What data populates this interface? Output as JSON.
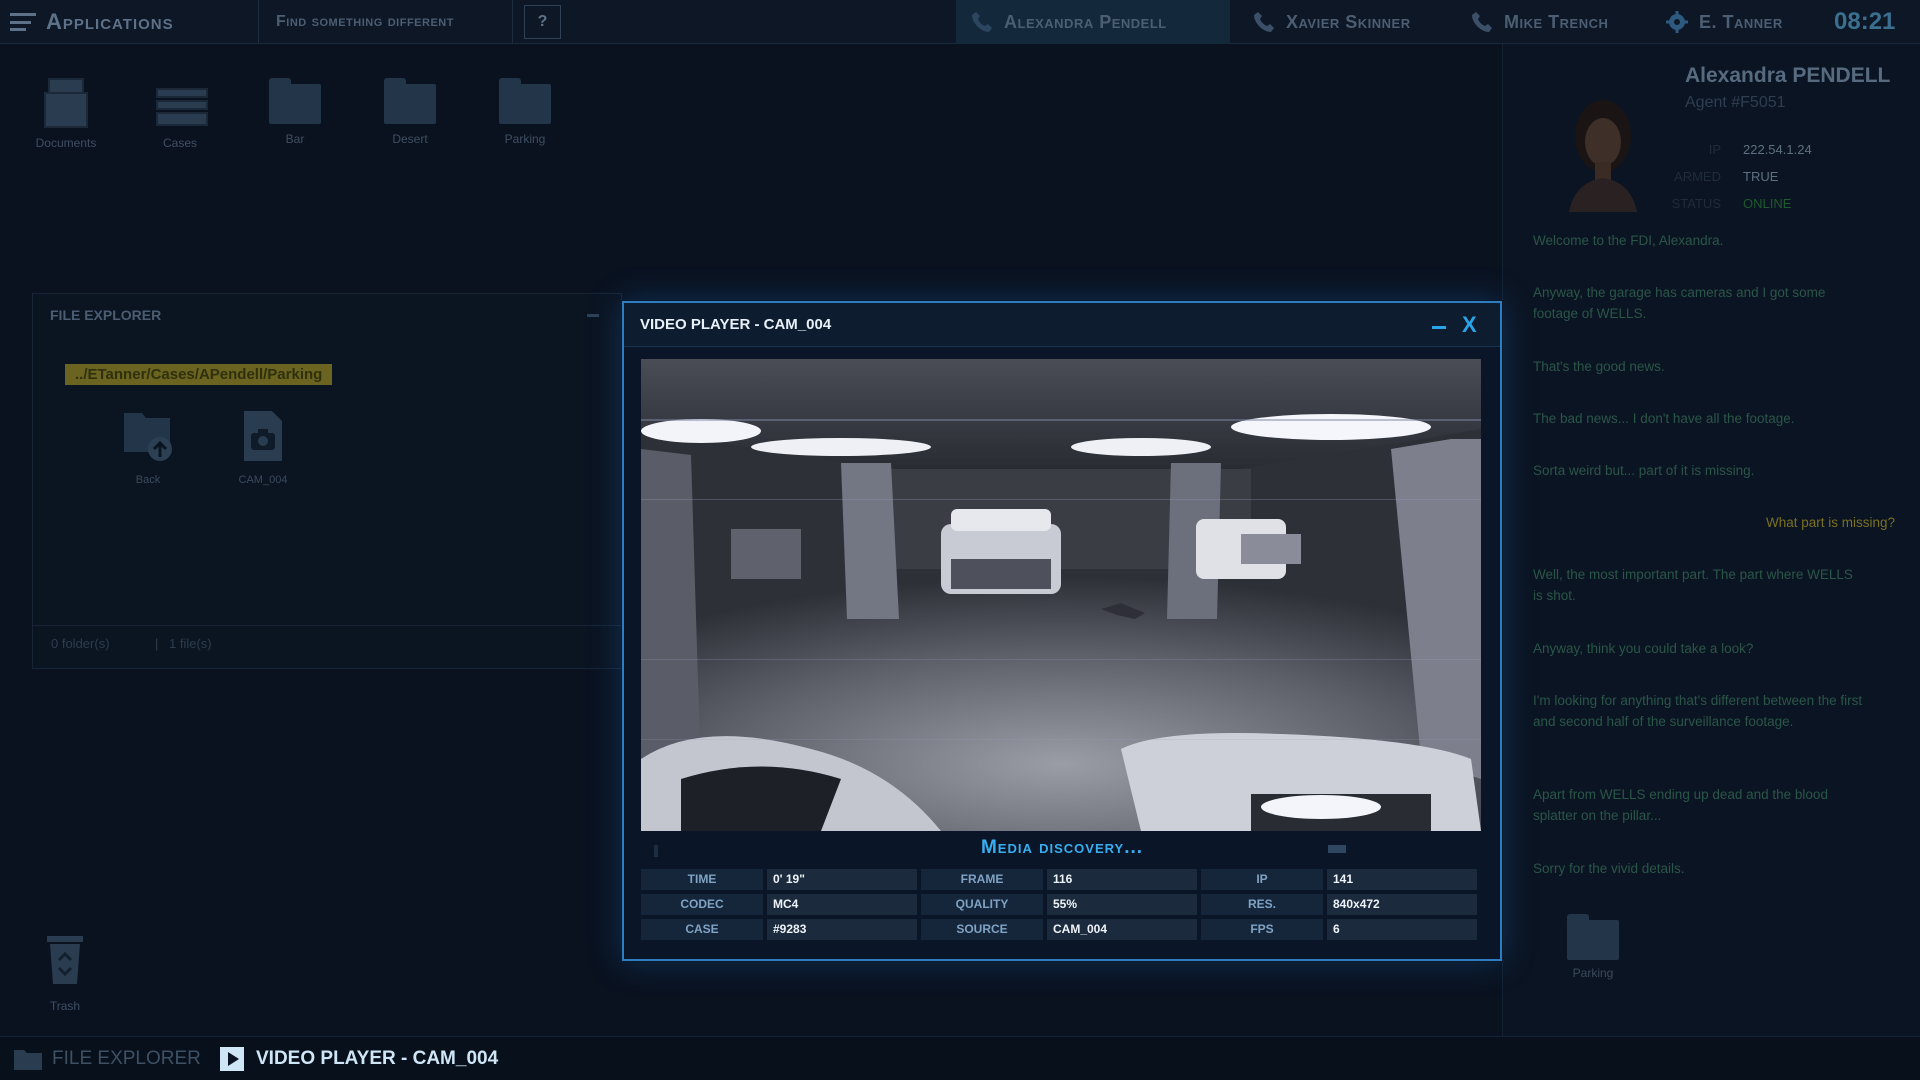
{
  "topbar": {
    "apps_label": "Applications",
    "find_label": "Find something different",
    "help_label": "?",
    "contacts": [
      "Alexandra Pendell",
      "Xavier Skinner",
      "Mike Trench"
    ],
    "user": "E. Tanner",
    "clock": "08:21"
  },
  "desktop": {
    "icons": [
      {
        "label": "Documents",
        "icon": "documents-icon"
      },
      {
        "label": "Cases",
        "icon": "cases-icon"
      },
      {
        "label": "Bar",
        "icon": "folder-icon"
      },
      {
        "label": "Desert",
        "icon": "folder-icon"
      },
      {
        "label": "Parking",
        "icon": "folder-icon"
      }
    ],
    "trash_label": "Trash"
  },
  "file_explorer": {
    "title": "FILE EXPLORER",
    "path": "../ETanner/Cases/APendell/Parking",
    "items": [
      {
        "label": "Back",
        "icon": "folder-back-icon"
      },
      {
        "label": "CAM_004",
        "icon": "video-file-icon"
      }
    ],
    "folders_count": "0 folder(s)",
    "files_count": "1 file(s)"
  },
  "video_player": {
    "title": "VIDEO PLAYER - CAM_004",
    "close_label": "X",
    "status": "Media discovery...",
    "fields": [
      [
        {
          "k": "TIME",
          "v": "0' 19\""
        },
        {
          "k": "FRAME",
          "v": "116"
        },
        {
          "k": "IP",
          "v": "141"
        }
      ],
      [
        {
          "k": "CODEC",
          "v": "MC4"
        },
        {
          "k": "QUALITY",
          "v": "55%"
        },
        {
          "k": "RES.",
          "v": "840x472"
        }
      ],
      [
        {
          "k": "CASE",
          "v": "#9283"
        },
        {
          "k": "SOURCE",
          "v": "CAM_004"
        },
        {
          "k": "FPS",
          "v": "6"
        }
      ]
    ]
  },
  "chat": {
    "agent_name": "Alexandra PENDELL",
    "agent_id": "Agent #F5051",
    "info": [
      {
        "k": "IP",
        "v": "222.54.1.24"
      },
      {
        "k": "ARMED",
        "v": "TRUE"
      },
      {
        "k": "STATUS",
        "v": "ONLINE"
      }
    ],
    "messages": [
      {
        "from": "them",
        "text": "Welcome to the FDI, Alexandra."
      },
      {
        "from": "them",
        "text": "Anyway, the garage has cameras and I got some footage of WELLS."
      },
      {
        "from": "them",
        "text": "That's the good news."
      },
      {
        "from": "them",
        "text": "The bad news... I don't have all the footage."
      },
      {
        "from": "them",
        "text": "Sorta weird but... part of it is missing."
      },
      {
        "from": "me",
        "text": "What part is missing?"
      },
      {
        "from": "them",
        "text": "Well, the most important part. The part where WELLS is shot."
      },
      {
        "from": "them",
        "text": "Anyway, think you could take a look?"
      },
      {
        "from": "them",
        "text": "I'm looking for anything that's different between the first and second half of the surveillance footage."
      },
      {
        "from": "them",
        "text": "Apart from WELLS ending up dead and the blood splatter on the pillar..."
      },
      {
        "from": "them",
        "text": "Sorry for the vivid details."
      }
    ],
    "attachment_label": "Parking"
  },
  "taskbar": {
    "items": [
      "FILE EXPLORER",
      "VIDEO PLAYER - CAM_004"
    ]
  },
  "colors": {
    "accent": "#2aa4e8",
    "online": "#3fbf5a",
    "reply": "#c9b233"
  }
}
